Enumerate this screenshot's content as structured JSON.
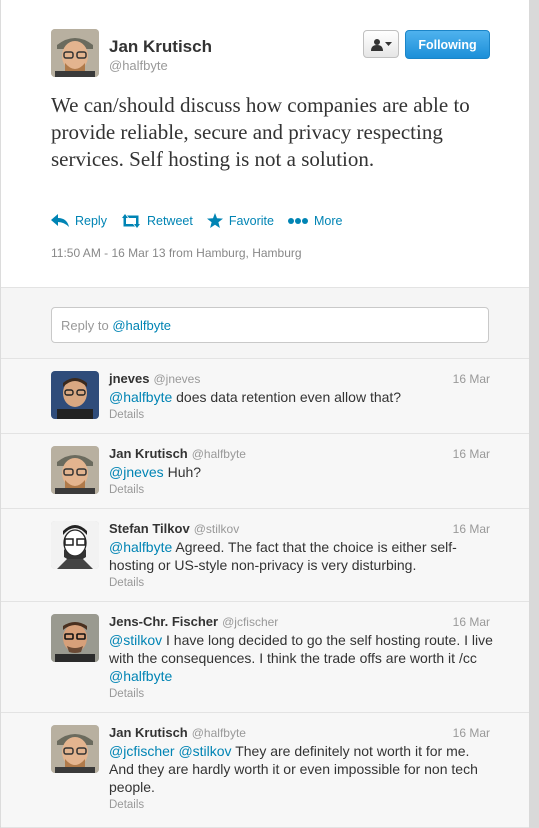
{
  "author": {
    "name": "Jan Krutisch",
    "handle": "@halfbyte"
  },
  "buttons": {
    "following": "Following"
  },
  "tweet": {
    "text": "We can/should discuss how companies are able to provide reliable, secure and privacy respecting services. Self hosting is not a solution.",
    "timestamp": "11:50 AM - 16 Mar 13 from Hamburg, Hamburg"
  },
  "actions": {
    "reply": "Reply",
    "retweet": "Retweet",
    "favorite": "Favorite",
    "more": "More"
  },
  "reply_box": {
    "prefix": "Reply to ",
    "mention": "@halfbyte"
  },
  "colors": {
    "link": "#0084b4",
    "follow_button": "#1c8fd8"
  },
  "replies": [
    {
      "name": "jneves",
      "handle": "@jneves",
      "time": "16 Mar",
      "mention": "@halfbyte",
      "text": " does data retention even allow that?",
      "details": "Details"
    },
    {
      "name": "Jan Krutisch",
      "handle": "@halfbyte",
      "time": "16 Mar",
      "mention": "@jneves",
      "text": " Huh?",
      "details": "Details"
    },
    {
      "name": "Stefan Tilkov",
      "handle": "@stilkov",
      "time": "16 Mar",
      "mention": "@halfbyte",
      "text": " Agreed. The fact that the choice is either self-hosting or US-style non-privacy is very disturbing.",
      "details": "Details"
    },
    {
      "name": "Jens-Chr. Fischer",
      "handle": "@jcfischer",
      "time": "16 Mar",
      "mention": "@stilkov",
      "text": " I have long decided to go the self hosting route. I live with the consequences. I think the trade offs are worth it /cc ",
      "mention2": "@halfbyte",
      "details": "Details"
    },
    {
      "name": "Jan Krutisch",
      "handle": "@halfbyte",
      "time": "16 Mar",
      "mention": "@jcfischer",
      "mention2": "@stilkov",
      "text": " They are definitely not worth it for me. And they are hardly worth it or even impossible for non tech people.",
      "details": "Details"
    }
  ]
}
